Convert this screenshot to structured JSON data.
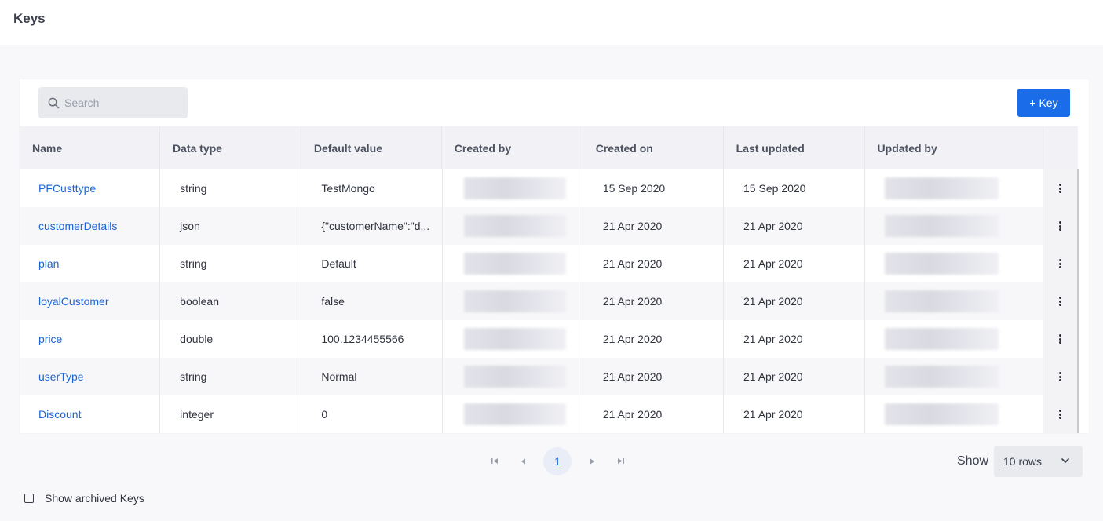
{
  "header": {
    "title": "Keys"
  },
  "search": {
    "placeholder": "Search"
  },
  "add_button": {
    "label": "+ Key"
  },
  "table": {
    "columns": [
      "Name",
      "Data type",
      "Default value",
      "Created by",
      "Created on",
      "Last updated",
      "Updated by"
    ],
    "rows": [
      {
        "name": "PFCusttype",
        "type": "string",
        "default": "TestMongo",
        "created_on": "15 Sep 2020",
        "last_updated": "15 Sep 2020"
      },
      {
        "name": "customerDetails",
        "type": "json",
        "default": "{\"customerName\":\"d...",
        "created_on": "21 Apr 2020",
        "last_updated": "21 Apr 2020"
      },
      {
        "name": "plan",
        "type": "string",
        "default": "Default",
        "created_on": "21 Apr 2020",
        "last_updated": "21 Apr 2020"
      },
      {
        "name": "loyalCustomer",
        "type": "boolean",
        "default": "false",
        "created_on": "21 Apr 2020",
        "last_updated": "21 Apr 2020"
      },
      {
        "name": "price",
        "type": "double",
        "default": "100.1234455566",
        "created_on": "21 Apr 2020",
        "last_updated": "21 Apr 2020"
      },
      {
        "name": "userType",
        "type": "string",
        "default": "Normal",
        "created_on": "21 Apr 2020",
        "last_updated": "21 Apr 2020"
      },
      {
        "name": "Discount",
        "type": "integer",
        "default": "0",
        "created_on": "21 Apr 2020",
        "last_updated": "21 Apr 2020"
      }
    ]
  },
  "pagination": {
    "current_page": "1",
    "show_label": "Show",
    "rows_option": "10 rows"
  },
  "archived": {
    "label": "Show archived Keys"
  },
  "colors": {
    "accent": "#1a6ce8",
    "link": "#1a65d6"
  }
}
